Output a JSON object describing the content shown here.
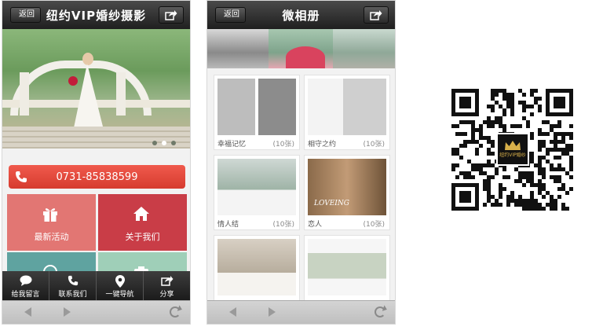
{
  "left_phone": {
    "header": {
      "back_label": "返回",
      "title": "纽约VIP婚纱摄影",
      "share_icon": "share-icon"
    },
    "hero": {
      "slider_dots": 3,
      "active_dot": 1
    },
    "call_button": {
      "label": "0731-85838599",
      "icon": "phone-icon"
    },
    "tiles": [
      {
        "label": "最新活动",
        "icon": "gift-icon",
        "color": "#e27673"
      },
      {
        "label": "关于我们",
        "icon": "home-icon",
        "color": "#c93d47"
      }
    ],
    "bottom_nav": [
      {
        "label": "给我留言",
        "icon": "chat-bubble-icon"
      },
      {
        "label": "联系我们",
        "icon": "phone-icon"
      },
      {
        "label": "一键导航",
        "icon": "location-pin-icon"
      },
      {
        "label": "分享",
        "icon": "share-icon"
      }
    ]
  },
  "right_phone": {
    "header": {
      "back_label": "返回",
      "title": "微相册",
      "share_icon": "share-icon"
    },
    "albums": [
      {
        "name": "幸福记忆",
        "count": "(10张)"
      },
      {
        "name": "相守之约",
        "count": "(10张)"
      },
      {
        "name": "情人结",
        "count": "(10张)"
      },
      {
        "name": "恋人",
        "count": "(10张)",
        "overlay": "LOVEING"
      },
      {
        "name": "",
        "count": ""
      },
      {
        "name": "",
        "count": ""
      }
    ]
  },
  "qr": {
    "logo_text": "纽约VIP婚纱"
  }
}
